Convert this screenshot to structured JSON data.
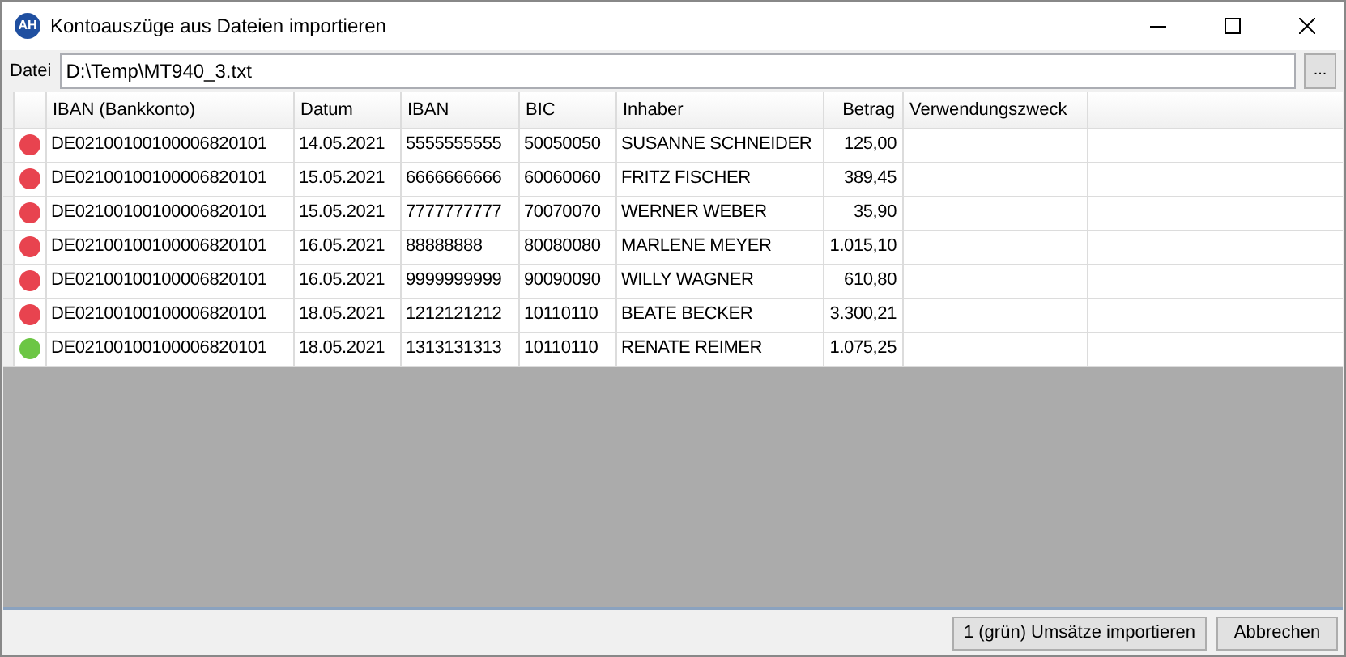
{
  "window": {
    "title": "Kontoauszüge aus Dateien importieren",
    "logo": "AH"
  },
  "file": {
    "label": "Datei",
    "value": "D:\\Temp\\MT940_3.txt",
    "browse": "..."
  },
  "table": {
    "columns": [
      "IBAN (Bankkonto)",
      "Datum",
      "IBAN",
      "BIC",
      "Inhaber",
      "Betrag",
      "Verwendungszweck"
    ],
    "rows": [
      {
        "color": "#e8434f",
        "cells": [
          "DE02100100100006820101",
          "14.05.2021",
          "5555555555",
          "50050050",
          "SUSANNE SCHNEIDER",
          "125,00"
        ]
      },
      {
        "color": "#e8434f",
        "cells": [
          "DE02100100100006820101",
          "15.05.2021",
          "6666666666",
          "60060060",
          "FRITZ FISCHER",
          "389,45"
        ]
      },
      {
        "color": "#e8434f",
        "cells": [
          "DE02100100100006820101",
          "15.05.2021",
          "7777777777",
          "70070070",
          "WERNER WEBER",
          "35,90"
        ]
      },
      {
        "color": "#e8434f",
        "cells": [
          "DE02100100100006820101",
          "16.05.2021",
          "88888888",
          "80080080",
          "MARLENE MEYER",
          "1.015,10"
        ]
      },
      {
        "color": "#e8434f",
        "cells": [
          "DE02100100100006820101",
          "16.05.2021",
          "9999999999",
          "90090090",
          "WILLY WAGNER",
          "610,80"
        ]
      },
      {
        "color": "#e8434f",
        "cells": [
          "DE02100100100006820101",
          "18.05.2021",
          "1212121212",
          "10110110",
          "BEATE BECKER",
          "3.300,21"
        ]
      },
      {
        "color": "#6cc644",
        "cells": [
          "DE02100100100006820101",
          "18.05.2021",
          "1313131313",
          "10110110",
          "RENATE REIMER",
          "1.075,25"
        ]
      }
    ]
  },
  "buttons": [
    "1 (grün) Umsätze importieren",
    "Abbrechen"
  ]
}
